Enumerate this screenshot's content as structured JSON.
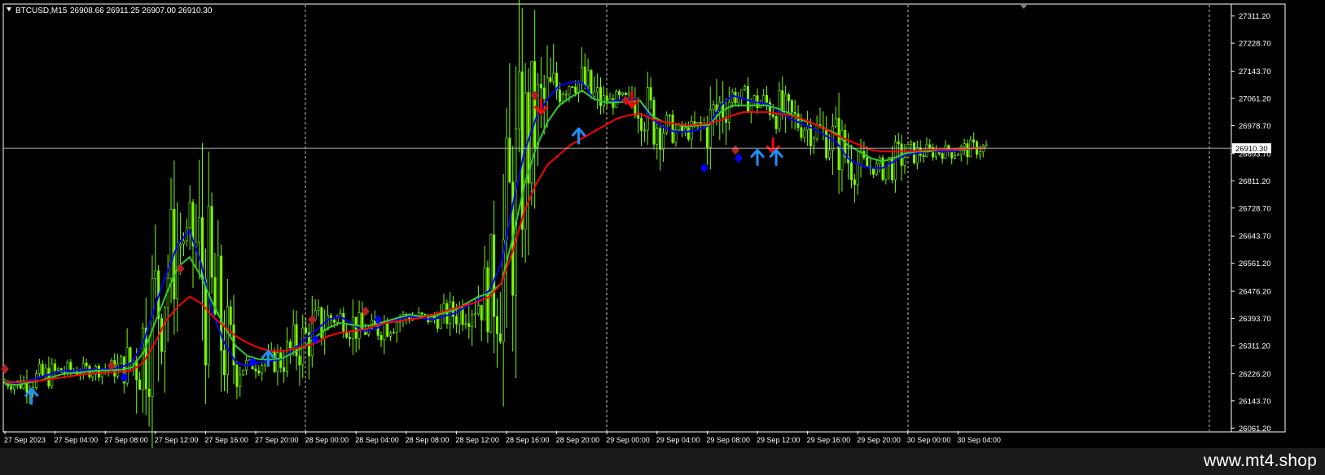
{
  "header": {
    "symbol": "BTCUSD,M15",
    "ohlc": "26908.66 26911.25 26907.00 26910.30"
  },
  "footer": {
    "watermark": "www.mt4.shop"
  },
  "colors": {
    "background": "#000000",
    "candle": "#7CFC00",
    "ma_fast": "#0000ff",
    "ma_mid": "#32cd32",
    "ma_slow": "#ff0000",
    "buy_arrow": "#1e90ff",
    "sell_arrow": "#ff0000",
    "buy_diamond": "#0000ff",
    "sell_diamond": "#b22222",
    "grid": "#ffffff",
    "price_line": "#c0c0c0"
  },
  "chart_data": {
    "type": "candlestick",
    "symbol": "BTCUSD",
    "timeframe": "M15",
    "current_price": "26910.30",
    "y_ticks": [
      "27311.20",
      "27228.70",
      "27143.70",
      "27061.20",
      "26978.70",
      "26893.70",
      "26811.20",
      "26728.70",
      "26643.70",
      "26561.20",
      "26476.20",
      "26393.70",
      "26311.20",
      "26226.20",
      "26143.70",
      "26061.20"
    ],
    "ylim": [
      26052,
      27345
    ],
    "x_ticks": [
      "27 Sep 2023",
      "27 Sep 04:00",
      "27 Sep 08:00",
      "27 Sep 12:00",
      "27 Sep 16:00",
      "27 Sep 20:00",
      "28 Sep 00:00",
      "28 Sep 04:00",
      "28 Sep 08:00",
      "28 Sep 12:00",
      "28 Sep 16:00",
      "28 Sep 20:00",
      "29 Sep 00:00",
      "29 Sep 04:00",
      "29 Sep 08:00",
      "29 Sep 12:00",
      "29 Sep 16:00",
      "29 Sep 20:00",
      "30 Sep 00:00",
      "30 Sep 04:00"
    ],
    "bars_per_tick": 16,
    "grid": "vertical separators at 28 Sep 00:00, 28 Sep 23:00 approx, 29 Sep 23:00 approx",
    "series": [
      {
        "key": "ma_fast",
        "values": [
          26200,
          26195,
          26205,
          26215,
          26225,
          26235,
          26235,
          26238,
          26238,
          26240,
          26245,
          26260,
          26320,
          26430,
          26530,
          26620,
          26660,
          26560,
          26410,
          26320,
          26260,
          26250,
          26260,
          26265,
          26270,
          26300,
          26330,
          26360,
          26390,
          26400,
          26380,
          26355,
          26360,
          26380,
          26390,
          26400,
          26395,
          26390,
          26400,
          26410,
          26430,
          26450,
          26480,
          26560,
          26740,
          26900,
          27000,
          27060,
          27100,
          27110,
          27110,
          27060,
          27050,
          27055,
          27060,
          27055,
          27000,
          26975,
          26960,
          26960,
          26965,
          26980,
          27040,
          27070,
          27060,
          27050,
          27045,
          27025,
          27000,
          26985,
          26970,
          26950,
          26930,
          26880,
          26860,
          26850,
          26850,
          26870,
          26890,
          26895,
          26900,
          26900,
          26900,
          26905,
          26910,
          26912
        ]
      },
      {
        "key": "ma_mid",
        "values": [
          26195,
          26192,
          26198,
          26205,
          26215,
          26225,
          26228,
          26232,
          26235,
          26236,
          26238,
          26245,
          26290,
          26380,
          26470,
          26550,
          26580,
          26520,
          26440,
          26370,
          26310,
          26280,
          26270,
          26270,
          26272,
          26290,
          26310,
          26340,
          26365,
          26380,
          26375,
          26370,
          26375,
          26385,
          26395,
          26405,
          26400,
          26400,
          26410,
          26420,
          26440,
          26460,
          26470,
          26500,
          26640,
          26800,
          26910,
          26990,
          27040,
          27065,
          27085,
          27060,
          27050,
          27050,
          27050,
          27055,
          27010,
          26990,
          26985,
          26975,
          26980,
          26980,
          27020,
          27040,
          27040,
          27040,
          27040,
          27030,
          27015,
          26995,
          26985,
          26970,
          26955,
          26920,
          26900,
          26880,
          26870,
          26880,
          26895,
          26900,
          26900,
          26905,
          26905,
          26905,
          26910,
          26912
        ]
      },
      {
        "key": "ma_slow",
        "values": [
          26200,
          26200,
          26202,
          26205,
          26210,
          26215,
          26220,
          26225,
          26228,
          26230,
          26232,
          26236,
          26260,
          26320,
          26390,
          26430,
          26460,
          26440,
          26400,
          26370,
          26340,
          26320,
          26305,
          26295,
          26295,
          26300,
          26310,
          26320,
          26340,
          26350,
          26355,
          26360,
          26370,
          26380,
          26385,
          26390,
          26395,
          26405,
          26415,
          26425,
          26435,
          26445,
          26460,
          26500,
          26600,
          26720,
          26800,
          26860,
          26890,
          26920,
          26940,
          26960,
          26980,
          27000,
          27010,
          27015,
          27000,
          26990,
          26985,
          26980,
          26982,
          26985,
          26995,
          27010,
          27020,
          27020,
          27020,
          27015,
          27010,
          27000,
          26985,
          26970,
          26950,
          26935,
          26920,
          26905,
          26900,
          26900,
          26900,
          26902,
          26905,
          26905,
          26905,
          26908,
          26910,
          26910
        ]
      }
    ],
    "signals": [
      {
        "kind": "sell_diamond",
        "bar": 0,
        "price": 26240
      },
      {
        "kind": "buy_arrow",
        "bar": 8.5,
        "price": 26155
      },
      {
        "kind": "sell_diamond",
        "bar": 34,
        "price": 26250
      },
      {
        "kind": "buy_diamond",
        "bar": 38,
        "price": 26215
      },
      {
        "kind": "sell_diamond",
        "bar": 56,
        "price": 26545
      },
      {
        "kind": "buy_diamond",
        "bar": 79,
        "price": 26262
      },
      {
        "kind": "buy_arrow",
        "bar": 84,
        "price": 26270
      },
      {
        "kind": "sell_diamond",
        "bar": 98,
        "price": 26390
      },
      {
        "kind": "buy_diamond",
        "bar": 99,
        "price": 26330
      },
      {
        "kind": "sell_diamond",
        "bar": 115,
        "price": 26415
      },
      {
        "kind": "buy_diamond",
        "bar": 119,
        "price": 26390
      },
      {
        "kind": "sell_diamond",
        "bar": 169,
        "price": 27070
      },
      {
        "kind": "sell_arrow",
        "bar": 171,
        "price": 27040
      },
      {
        "kind": "buy_arrow",
        "bar": 183,
        "price": 26945
      },
      {
        "kind": "sell_diamond",
        "bar": 198,
        "price": 27055
      },
      {
        "kind": "sell_arrow",
        "bar": 200,
        "price": 27060
      },
      {
        "kind": "buy_diamond",
        "bar": 223,
        "price": 26850
      },
      {
        "kind": "sell_diamond",
        "bar": 233,
        "price": 26905
      },
      {
        "kind": "buy_diamond",
        "bar": 234,
        "price": 26880
      },
      {
        "kind": "buy_arrow",
        "bar": 240,
        "price": 26880
      },
      {
        "kind": "sell_arrow",
        "bar": 245,
        "price": 26920
      },
      {
        "kind": "buy_arrow",
        "bar": 246,
        "price": 26880
      }
    ]
  }
}
